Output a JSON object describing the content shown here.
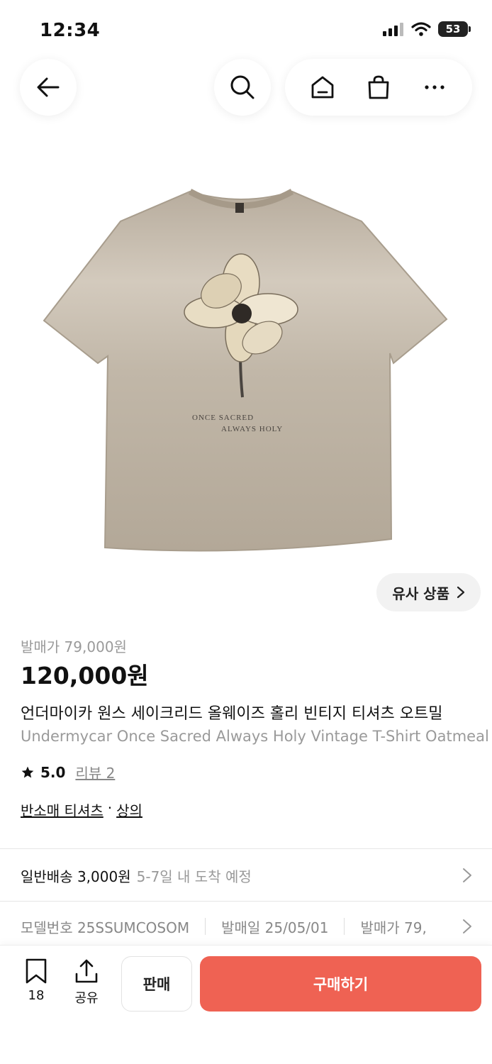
{
  "status_bar": {
    "time": "12:34",
    "battery": "53"
  },
  "icons": {
    "back": "arrow-left-icon",
    "search": "search-icon",
    "home": "home-icon",
    "cart": "shopping-bag-icon",
    "more": "more-horizontal-icon"
  },
  "product": {
    "image_text": [
      "ONCE SACRED",
      "ALWAYS HOLY"
    ],
    "similar_label": "유사 상품",
    "release_line": "발매가 79,000원",
    "price": "120,000원",
    "title_ko": "언더마이카 원스 세이크리드 올웨이즈 홀리 빈티지 티셔츠 오트밀",
    "title_en": "Undermycar Once Sacred Always Holy Vintage T-Shirt Oatmeal",
    "rating": "5.0",
    "review_link": "리뷰 2",
    "categories": [
      "반소매 티셔츠",
      "상의"
    ],
    "category_sep": "·"
  },
  "shipping": {
    "main": "일반배송 3,000원",
    "eta": "5-7일 내 도착 예정"
  },
  "info": {
    "model": "모델번호 25SSUMCOSOM",
    "release_date": "발매일 25/05/01",
    "release_price": "발매가 79,"
  },
  "bottom_bar": {
    "bookmark_count": "18",
    "share_label": "공유",
    "sell_label": "판매",
    "buy_label": "구매하기"
  },
  "colors": {
    "accent": "#ef6253",
    "muted_text": "#9a9a9a",
    "shirt": "#b9ae9f"
  }
}
